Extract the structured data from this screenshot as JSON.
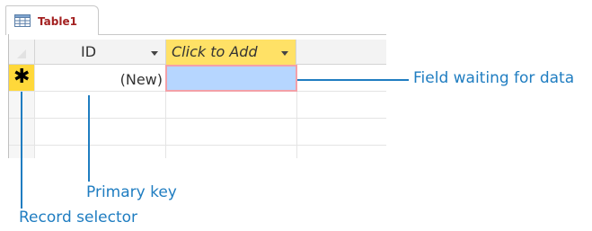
{
  "table_tab": {
    "title": "Table1",
    "icon": "table-icon"
  },
  "datasheet": {
    "columns": [
      {
        "label": "ID",
        "has_dropdown": true
      },
      {
        "label": "Click to Add",
        "has_dropdown": true,
        "highlight_color": "#ffe166"
      }
    ],
    "new_record": {
      "selector_symbol": "✱",
      "selector_color": "#ffd83a",
      "id_value": "(New)",
      "empty_field_color": "#b6d6ff"
    }
  },
  "callouts": {
    "color": "#1f7dc1",
    "field_waiting": "Field waiting for data",
    "primary_key": "Primary key",
    "record_selector": "Record selector"
  }
}
